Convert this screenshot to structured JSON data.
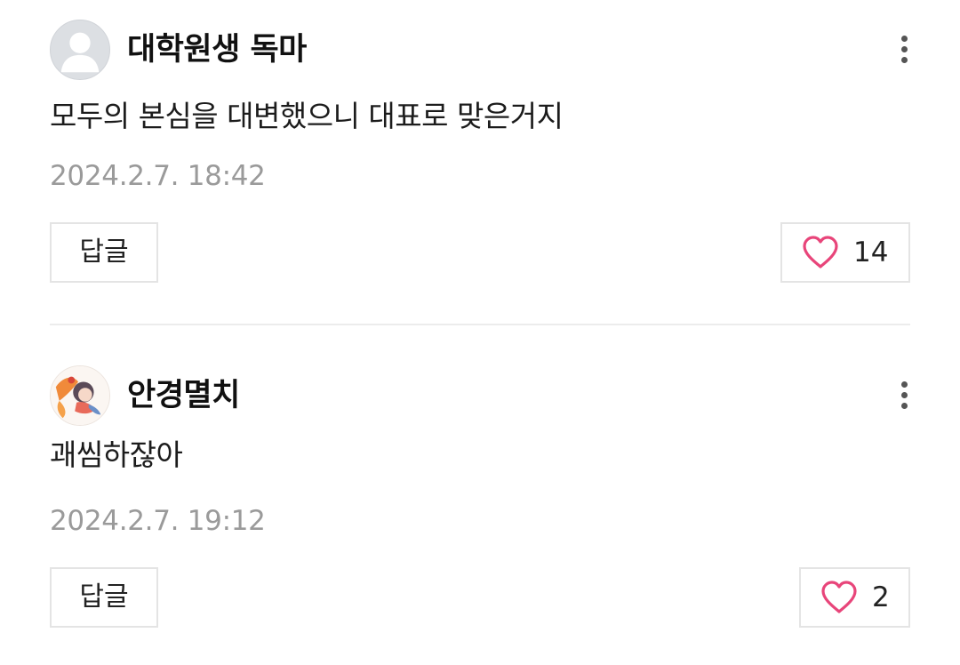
{
  "comments": [
    {
      "username": "대학원생 독마",
      "text": "모두의 본심을 대변했으니 대표로 맞은거지",
      "timestamp": "2024.2.7. 18:42",
      "reply_label": "답글",
      "likes": "14",
      "avatar": "default-profile-icon"
    },
    {
      "username": "안경멸치",
      "text": "괘씸하잖아",
      "timestamp": "2024.2.7. 19:12",
      "reply_label": "답글",
      "likes": "2",
      "avatar": "anime-character-avatar"
    }
  ],
  "icons": {
    "more": "more-vertical-icon",
    "like": "heart-outline-icon"
  },
  "colors": {
    "heart": "#e8457a",
    "timestamp": "#9a9a9a",
    "border": "#e4e4e4"
  }
}
